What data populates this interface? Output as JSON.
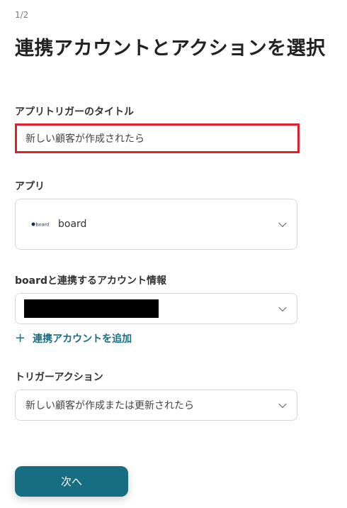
{
  "header": {
    "step": "1/2",
    "title": "連携アカウントとアクションを選択"
  },
  "trigger_title": {
    "label": "アプリトリガーのタイトル",
    "value": "新しい顧客が作成されたら"
  },
  "app": {
    "label": "アプリ",
    "logo_text": "board",
    "name": "board"
  },
  "account": {
    "label": "boardと連携するアカウント情報",
    "add_link": "連携アカウントを追加"
  },
  "trigger_action": {
    "label": "トリガーアクション",
    "value": "新しい顧客が作成または更新されたら"
  },
  "footer": {
    "next_label": "次へ"
  },
  "colors": {
    "accent": "#176d82",
    "highlight_border": "#e0202e"
  }
}
